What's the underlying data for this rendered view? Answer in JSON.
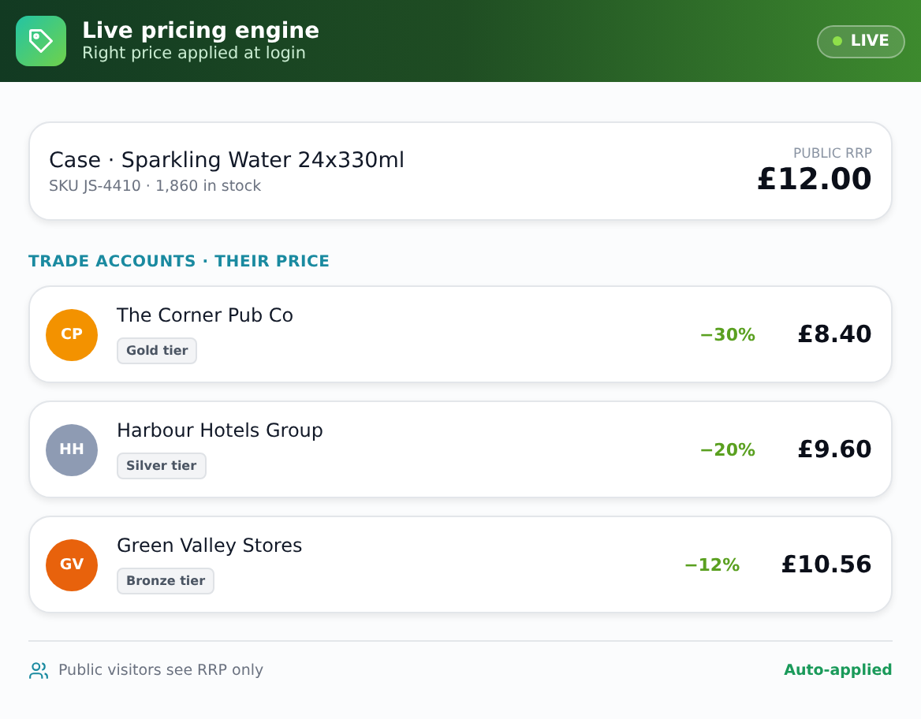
{
  "header": {
    "title": "Live pricing engine",
    "subtitle": "Right price applied at login",
    "status": {
      "label": "LIVE",
      "on": true
    }
  },
  "product": {
    "name": "Case · Sparkling Water 24x330ml",
    "meta": "SKU JS-4410 · 1,860 in stock",
    "price_label": "PUBLIC RRP",
    "price": "£12.00"
  },
  "section_title": "TRADE ACCOUNTS · THEIR PRICE",
  "accounts": [
    {
      "initials": "CP",
      "name": "The Corner Pub Co",
      "tier": "Gold tier",
      "discount": "−30%",
      "price": "£8.40",
      "color": "#f39200"
    },
    {
      "initials": "HH",
      "name": "Harbour Hotels Group",
      "tier": "Silver tier",
      "discount": "−20%",
      "price": "£9.60",
      "color": "#8e9bb3"
    },
    {
      "initials": "GV",
      "name": "Green Valley Stores",
      "tier": "Bronze tier",
      "discount": "−12%",
      "price": "£10.56",
      "color": "#e8620c"
    }
  ],
  "footer": {
    "note": "Public visitors see RRP only",
    "status": "Auto-applied"
  }
}
